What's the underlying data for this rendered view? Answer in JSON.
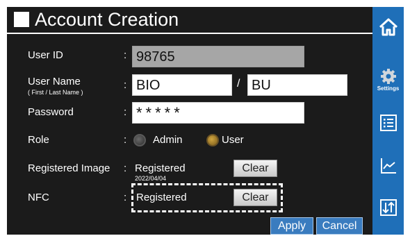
{
  "title": "Account Creation",
  "fields": {
    "user_id": {
      "label": "User ID",
      "value": "98765"
    },
    "user_name": {
      "label": "User Name",
      "sublabel": "( First / Last Name )",
      "first": "BIO",
      "separator": "/",
      "last": "BU"
    },
    "password": {
      "label": "Password",
      "value": "*****"
    },
    "role": {
      "label": "Role",
      "options": [
        "Admin",
        "User"
      ],
      "selected": "User"
    },
    "registered_image": {
      "label": "Registered Image",
      "status": "Registered",
      "date": "2022/04/04",
      "clear_label": "Clear"
    },
    "nfc": {
      "label": "NFC",
      "status": "Registered",
      "clear_label": "Clear"
    }
  },
  "colon": ":",
  "actions": {
    "apply": "Apply",
    "cancel": "Cancel"
  },
  "sidebar": {
    "items": [
      {
        "icon": "home-icon",
        "label": ""
      },
      {
        "icon": "settings-gear-icon",
        "label": "Settings"
      },
      {
        "icon": "list-icon",
        "label": ""
      },
      {
        "icon": "chart-icon",
        "label": ""
      },
      {
        "icon": "sort-icon",
        "label": ""
      }
    ]
  },
  "colors": {
    "background": "#1b1b1b",
    "sidebar": "#1f6fb8",
    "accent_button": "#3a7cbf",
    "selected_radio": "#c8a040"
  }
}
